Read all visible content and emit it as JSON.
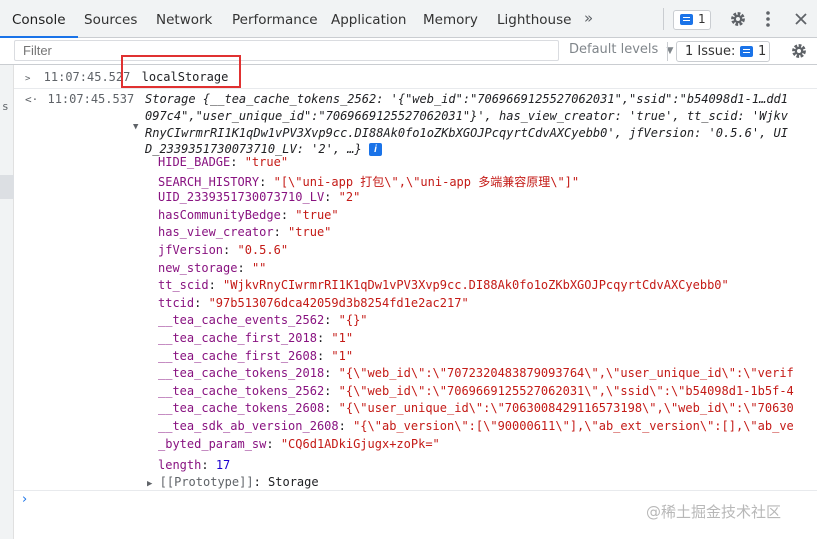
{
  "tabs": {
    "elements": "Console",
    "sources": "Sources",
    "network": "Network",
    "performance": "Performance",
    "application": "Application",
    "memory": "Memory",
    "lighthouse": "Lighthouse",
    "more_icon": "»"
  },
  "toolbar": {
    "issues_count": "1",
    "settings_icon": "gear-icon",
    "menu_icon": "more-vert-icon",
    "close_icon": "close-icon"
  },
  "filter": {
    "placeholder": "Filter",
    "default_levels": "Default levels",
    "issues_label": "1 Issue:",
    "issues_count": "1"
  },
  "console": {
    "entry1": {
      "time": "11:07:45.527",
      "command": "localStorage"
    },
    "entry2": {
      "time": "11:07:45.537",
      "line1": "Storage {__tea_cache_tokens_2562: '{\"web_id\":\"7069669125527062031\",\"ssid\":\"b54098d1-1…dd1",
      "line2": "097c4\",\"user_unique_id\":\"7069669125527062031\"}', has_view_creator: 'true', tt_scid: 'Wjkv",
      "line3": "RnyCIwrmrRI1K1qDw1vPV3Xvp9cc.DI88Ak0fo1oZKbXGOJPcqyrtCdvAXCyebb0', jfVersion: '0.5.6', UI",
      "line4": "D_2339351730073710_LV: '2', …}",
      "info": "i"
    },
    "props": [
      {
        "key": "HIDE_BADGE",
        "value": "\"true\""
      },
      {
        "key": "SEARCH_HISTORY",
        "value": "\"[\\\"uni-app 打包\\\",\\\"uni-app 多端兼容原理\\\"]\""
      },
      {
        "key": "UID_2339351730073710_LV",
        "value": "\"2\""
      },
      {
        "key": "hasCommunityBedge",
        "value": "\"true\""
      },
      {
        "key": "has_view_creator",
        "value": "\"true\""
      },
      {
        "key": "jfVersion",
        "value": "\"0.5.6\""
      },
      {
        "key": "new_storage",
        "value": "\"\""
      },
      {
        "key": "tt_scid",
        "value": "\"WjkvRnyCIwrmrRI1K1qDw1vPV3Xvp9cc.DI88Ak0fo1oZKbXGOJPcqyrtCdvAXCyebb0\""
      },
      {
        "key": "ttcid",
        "value": "\"97b513076dca42059d3b8254fd1e2ac217\""
      },
      {
        "key": "__tea_cache_events_2562",
        "value": "\"{}\""
      },
      {
        "key": "__tea_cache_first_2018",
        "value": "\"1\""
      },
      {
        "key": "__tea_cache_first_2608",
        "value": "\"1\""
      },
      {
        "key": "__tea_cache_tokens_2018",
        "value": "\"{\\\"web_id\\\":\\\"7072320483879093764\\\",\\\"user_unique_id\\\":\\\"verif"
      },
      {
        "key": "__tea_cache_tokens_2562",
        "value": "\"{\\\"web_id\\\":\\\"7069669125527062031\\\",\\\"ssid\\\":\\\"b54098d1-1b5f-4"
      },
      {
        "key": "__tea_cache_tokens_2608",
        "value": "\"{\\\"user_unique_id\\\":\\\"7063008429116573198\\\",\\\"web_id\\\":\\\"70630"
      },
      {
        "key": "__tea_sdk_ab_version_2608",
        "value": "\"{\\\"ab_version\\\":[\\\"90000611\\\"],\\\"ab_ext_version\\\":[],\\\"ab_ve"
      },
      {
        "key": "_byted_param_sw",
        "value": "\"CQ6d1ADkiGjugx+zoPk=\""
      }
    ],
    "length": {
      "key": "length",
      "value": "17"
    },
    "prototype": {
      "key": "[[Prototype]]",
      "value": "Storage"
    }
  },
  "watermark": "@稀土掘金技术社区"
}
